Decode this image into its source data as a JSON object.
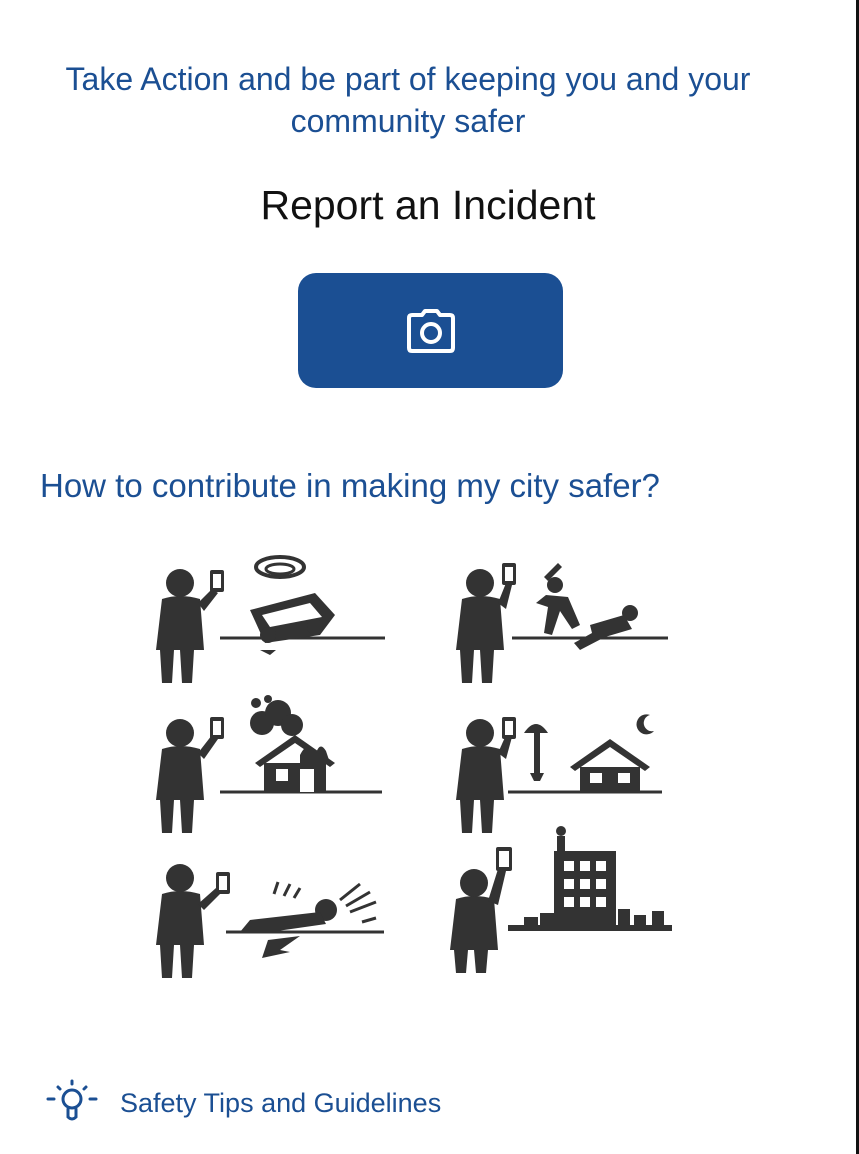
{
  "header": {
    "tagline": "Take Action and be part of keeping you and your community safer"
  },
  "report": {
    "title": "Report an Incident",
    "camera_icon": "camera-icon",
    "button_color": "#1b4f93"
  },
  "contribute": {
    "title": "How to contribute in making my city safer?",
    "illustrations": [
      {
        "icon": "car-accident-icon"
      },
      {
        "icon": "assault-icon"
      },
      {
        "icon": "house-fire-icon"
      },
      {
        "icon": "night-burglary-icon"
      },
      {
        "icon": "injured-person-icon"
      },
      {
        "icon": "rooftop-danger-icon"
      }
    ]
  },
  "footer": {
    "tips_label": "Safety Tips and Guidelines",
    "tips_icon": "lightbulb-icon"
  },
  "colors": {
    "accent": "#1b4f93",
    "figure": "#333333"
  }
}
